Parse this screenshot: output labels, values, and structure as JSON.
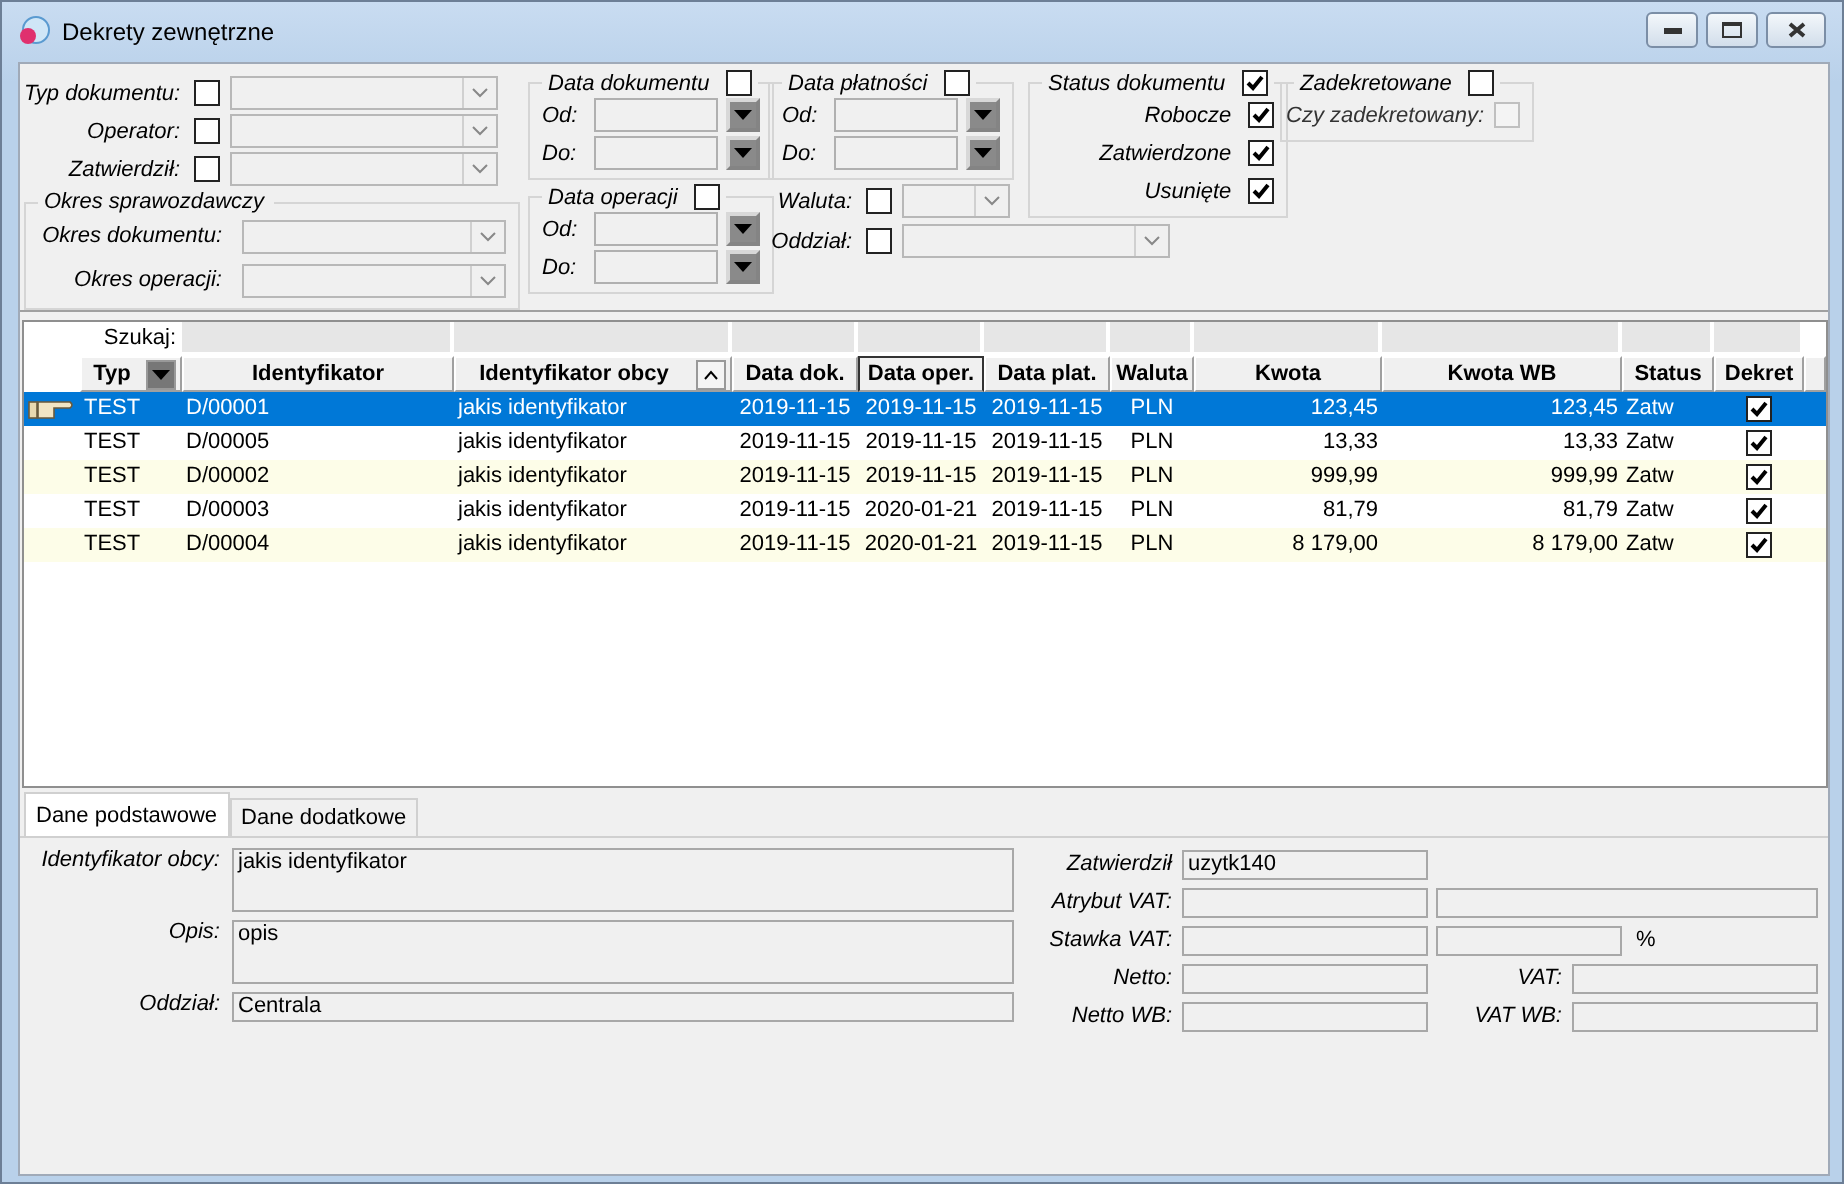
{
  "window": {
    "title": "Dekrety zewnętrzne"
  },
  "filter_rows": [
    {
      "label": "Typ dokumentu:",
      "checked": false
    },
    {
      "label": "Operator:",
      "checked": false
    },
    {
      "label": "Zatwierdził:",
      "checked": false
    }
  ],
  "reporting_period": {
    "title": "Okres sprawozdawczy",
    "fields": [
      {
        "label": "Okres dokumentu:"
      },
      {
        "label": "Okres operacji:"
      }
    ]
  },
  "date_groups": [
    {
      "title": "Data dokumentu",
      "checked": false,
      "from_label": "Od:",
      "to_label": "Do:"
    },
    {
      "title": "Data operacji",
      "checked": false,
      "from_label": "Od:",
      "to_label": "Do:"
    },
    {
      "title": "Data płatności",
      "checked": false,
      "from_label": "Od:",
      "to_label": "Do:"
    }
  ],
  "extra_filters": [
    {
      "label": "Waluta:",
      "checked": false
    },
    {
      "label": "Oddział:",
      "checked": false
    }
  ],
  "status_group": {
    "title": "Status dokumentu",
    "checked": true,
    "options": [
      {
        "label": "Robocze",
        "checked": true
      },
      {
        "label": "Zatwierdzone",
        "checked": true
      },
      {
        "label": "Usunięte",
        "checked": true
      }
    ]
  },
  "posted_group": {
    "title": "Zadekretowane",
    "checked": false,
    "option": {
      "label": "Czy zadekretowany:",
      "checked": false,
      "disabled": true
    }
  },
  "grid": {
    "search_label": "Szukaj:",
    "columns": [
      {
        "label": "Typ",
        "kind": "text",
        "filter_button": true,
        "sorted": false,
        "selected": false
      },
      {
        "label": "Identyfikator",
        "kind": "text",
        "filter_button": false,
        "sorted": false,
        "selected": false
      },
      {
        "label": "Identyfikator obcy",
        "kind": "text",
        "filter_button": false,
        "sorted": true,
        "selected": false
      },
      {
        "label": "Data dok.",
        "kind": "date",
        "filter_button": false,
        "sorted": false,
        "selected": false
      },
      {
        "label": "Data oper.",
        "kind": "date",
        "filter_button": false,
        "sorted": false,
        "selected": true
      },
      {
        "label": "Data plat.",
        "kind": "date",
        "filter_button": false,
        "sorted": false,
        "selected": false
      },
      {
        "label": "Waluta",
        "kind": "code",
        "filter_button": false,
        "sorted": false,
        "selected": false
      },
      {
        "label": "Kwota",
        "kind": "amount",
        "filter_button": false,
        "sorted": false,
        "selected": false
      },
      {
        "label": "Kwota WB",
        "kind": "amount",
        "filter_button": false,
        "sorted": false,
        "selected": false
      },
      {
        "label": "Status",
        "kind": "status",
        "filter_button": false,
        "sorted": false,
        "selected": false
      },
      {
        "label": "Dekret",
        "kind": "check",
        "filter_button": false,
        "sorted": false,
        "selected": false
      }
    ],
    "rows": [
      {
        "selected": true,
        "posted": true,
        "cells": [
          "TEST",
          "D/00001",
          "jakis identyfikator",
          "2019-11-15",
          "2019-11-15",
          "2019-11-15",
          "PLN",
          "123,45",
          "123,45",
          "Zatw"
        ]
      },
      {
        "selected": false,
        "posted": true,
        "cells": [
          "TEST",
          "D/00005",
          "jakis identyfikator",
          "2019-11-15",
          "2019-11-15",
          "2019-11-15",
          "PLN",
          "13,33",
          "13,33",
          "Zatw"
        ]
      },
      {
        "selected": false,
        "posted": true,
        "cells": [
          "TEST",
          "D/00002",
          "jakis identyfikator",
          "2019-11-15",
          "2019-11-15",
          "2019-11-15",
          "PLN",
          "999,99",
          "999,99",
          "Zatw"
        ]
      },
      {
        "selected": false,
        "posted": true,
        "cells": [
          "TEST",
          "D/00003",
          "jakis identyfikator",
          "2019-11-15",
          "2020-01-21",
          "2019-11-15",
          "PLN",
          "81,79",
          "81,79",
          "Zatw"
        ]
      },
      {
        "selected": false,
        "posted": true,
        "cells": [
          "TEST",
          "D/00004",
          "jakis identyfikator",
          "2019-11-15",
          "2020-01-21",
          "2019-11-15",
          "PLN",
          "8 179,00",
          "8 179,00",
          "Zatw"
        ]
      }
    ]
  },
  "detail_tabs": [
    {
      "label": "Dane podstawowe",
      "selected": true
    },
    {
      "label": "Dane dodatkowe",
      "selected": false
    }
  ],
  "details_left": [
    {
      "label": "Identyfikator obcy:",
      "value": "jakis identyfikator",
      "kind": "multiline"
    },
    {
      "label": "Opis:",
      "value": "opis",
      "kind": "multiline"
    },
    {
      "label": "Oddział:",
      "value": "Centrala",
      "kind": "single"
    }
  ],
  "details_right": [
    {
      "label": "Zatwierdził",
      "value": "uzytk140",
      "kind": "single"
    },
    {
      "label": "Atrybut VAT:",
      "kind": "pair"
    },
    {
      "label": "Stawka VAT:",
      "kind": "percent",
      "suffix": "%"
    },
    {
      "label": "Netto:",
      "kind": "labeled_pair",
      "second_label": "VAT:"
    },
    {
      "label": "Netto WB:",
      "kind": "labeled_pair",
      "second_label": "VAT WB:"
    }
  ]
}
